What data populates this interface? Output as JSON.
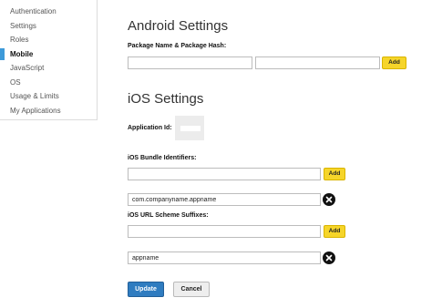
{
  "sidebar": {
    "items": [
      {
        "label": "Authentication"
      },
      {
        "label": "Settings"
      },
      {
        "label": "Roles"
      },
      {
        "label": "Mobile"
      },
      {
        "label": "JavaScript"
      },
      {
        "label": "OS"
      },
      {
        "label": "Usage & Limits"
      },
      {
        "label": "My Applications"
      }
    ],
    "active_item": "Mobile"
  },
  "android": {
    "title": "Android Settings",
    "package_label": "Package Name & Package Hash:",
    "package_name_value": "",
    "package_hash_value": "",
    "add_label": "Add"
  },
  "ios": {
    "title": "iOS Settings",
    "app_id_label": "Application Id:",
    "app_id_value": "",
    "bundle_label": "iOS Bundle Identifiers:",
    "bundle_input_value": "",
    "bundle_add_label": "Add",
    "bundle_entry": "com.companyname.appname",
    "scheme_label": "iOS URL Scheme Suffixes:",
    "scheme_input_value": "",
    "scheme_add_label": "Add",
    "scheme_entry": "appname"
  },
  "actions": {
    "update_label": "Update",
    "cancel_label": "Cancel"
  },
  "colors": {
    "accent_blue": "#3d9ad9",
    "add_button": "#f6d52a",
    "update_button": "#2f7cc0"
  }
}
